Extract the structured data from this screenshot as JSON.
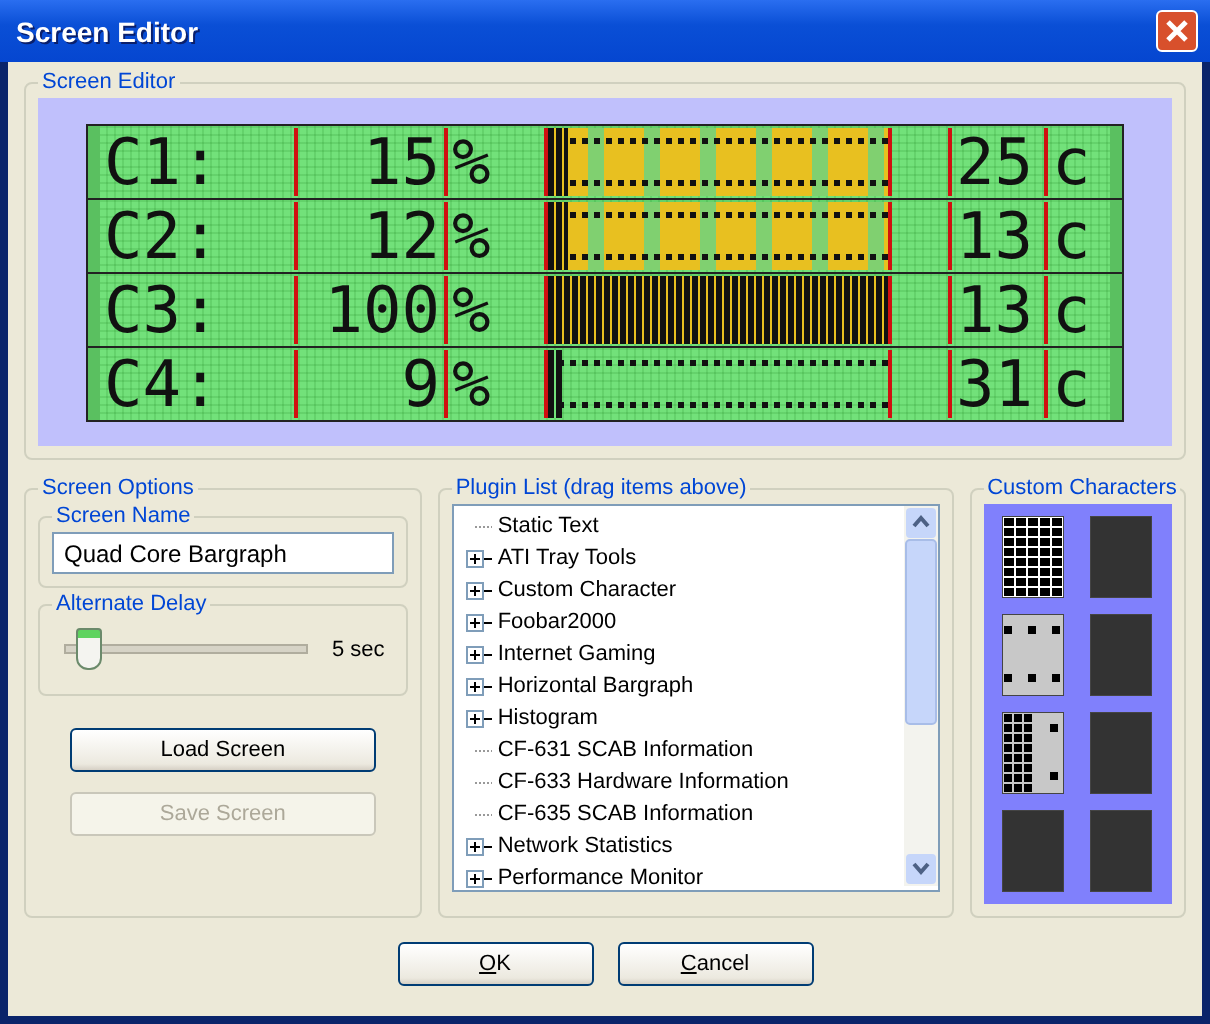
{
  "window": {
    "title": "Screen Editor"
  },
  "screen_editor": {
    "title": "Screen Editor",
    "rows": [
      {
        "label": "C1:",
        "value": "15",
        "unit": "%",
        "level": 0.06,
        "highlighted": true,
        "temp": "25",
        "temp_unit": "c"
      },
      {
        "label": "C2:",
        "value": "12",
        "unit": "%",
        "level": 0.06,
        "highlighted": true,
        "temp": "13",
        "temp_unit": "c"
      },
      {
        "label": "C3:",
        "value": "100",
        "unit": "%",
        "level": 1,
        "highlighted": true,
        "temp": "13",
        "temp_unit": "c"
      },
      {
        "label": "C4:",
        "value": "9",
        "unit": "%",
        "level": 0.04,
        "highlighted": false,
        "temp": "31",
        "temp_unit": "c"
      }
    ]
  },
  "screen_options": {
    "title": "Screen Options",
    "screen_name": {
      "label": "Screen Name",
      "value": "Quad Core Bargraph"
    },
    "alternate_delay": {
      "label": "Alternate Delay",
      "level": 0.1,
      "reading": "5 sec"
    },
    "buttons": [
      {
        "label": "Load Screen",
        "disabled": false
      },
      {
        "label": "Save Screen",
        "disabled": true
      }
    ]
  },
  "plugin_list": {
    "title": "Plugin List (drag items above)",
    "items": [
      {
        "label": "Static Text",
        "expandable": false
      },
      {
        "label": "ATI Tray Tools",
        "expandable": true
      },
      {
        "label": "Custom Character",
        "expandable": true
      },
      {
        "label": "Foobar2000",
        "expandable": true
      },
      {
        "label": "Internet Gaming",
        "expandable": true
      },
      {
        "label": "Horizontal Bargraph",
        "expandable": true
      },
      {
        "label": "Histogram",
        "expandable": true
      },
      {
        "label": "CF-631 SCAB Information",
        "expandable": false
      },
      {
        "label": "CF-633 Hardware Information",
        "expandable": false
      },
      {
        "label": "CF-635 SCAB Information",
        "expandable": false
      },
      {
        "label": "Network Statistics",
        "expandable": true
      },
      {
        "label": "Performance Monitor",
        "expandable": true
      }
    ]
  },
  "custom_characters": {
    "title": "Custom Characters",
    "cells": [
      {
        "kind": "full"
      },
      {
        "kind": "blank"
      },
      {
        "kind": "dots"
      },
      {
        "kind": "blank"
      },
      {
        "kind": "half"
      },
      {
        "kind": "blank"
      },
      {
        "kind": "blank"
      },
      {
        "kind": "blank"
      }
    ]
  },
  "dialog_buttons": [
    "OK",
    "Cancel"
  ]
}
